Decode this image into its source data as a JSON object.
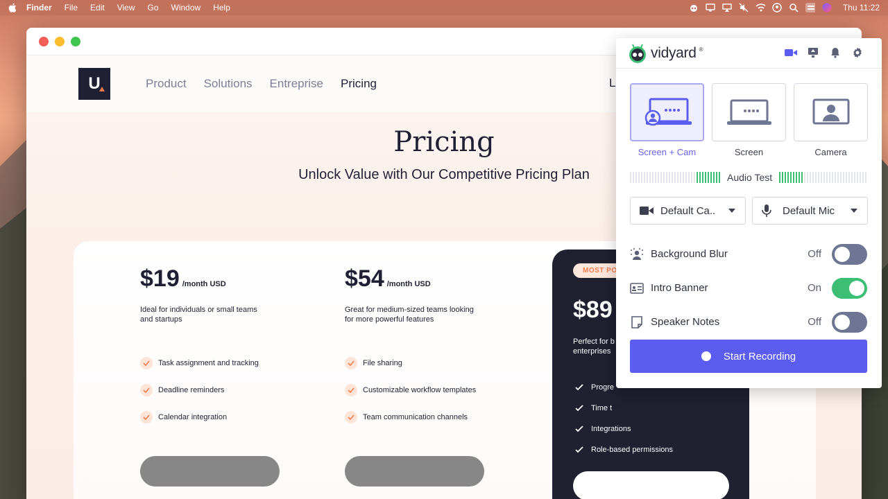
{
  "menubar": {
    "items": [
      "Finder",
      "File",
      "Edit",
      "View",
      "Go",
      "Window",
      "Help"
    ],
    "clock": "Thu 11:22"
  },
  "site": {
    "nav": [
      "Product",
      "Solutions",
      "Entreprise",
      "Pricing"
    ],
    "nav_right": "L",
    "logo_text": "U",
    "title": "Pricing",
    "subtitle": "Unlock Value with Our Competitive Pricing Plan",
    "plans": [
      {
        "price": "$19",
        "period": "/month USD",
        "desc": "Ideal for individuals or small teams and startups",
        "features": [
          "Task assignment and tracking",
          "Deadline reminders",
          "Calendar integration"
        ]
      },
      {
        "price": "$54",
        "period": "/month USD",
        "desc": "Great for medium-sized teams looking for more powerful features",
        "features": [
          "File sharing",
          "Customizable workflow templates",
          "Team communication channels"
        ]
      }
    ],
    "featured": {
      "badge": "MOST PO",
      "price": "$89",
      "desc": "Perfect for b enterprises",
      "features": [
        "Progre",
        "Time t",
        "Integrations",
        "Role-based permissions"
      ]
    }
  },
  "vidyard": {
    "brand": "vidyard",
    "reg": "®",
    "modes": [
      {
        "label": "Screen + Cam",
        "selected": true
      },
      {
        "label": "Screen",
        "selected": false
      },
      {
        "label": "Camera",
        "selected": false
      }
    ],
    "audio_test": "Audio Test",
    "camera_select": "Default Ca..",
    "mic_select": "Default Mic",
    "toggles": [
      {
        "label": "Background Blur",
        "state": "Off",
        "on": false
      },
      {
        "label": "Intro Banner",
        "state": "On",
        "on": true
      },
      {
        "label": "Speaker Notes",
        "state": "Off",
        "on": false
      }
    ],
    "record_label": "Start Recording",
    "colors": {
      "accent": "#5b5cf0",
      "toggle_on": "#3cbf75",
      "toggle_off": "#6e7694"
    }
  }
}
